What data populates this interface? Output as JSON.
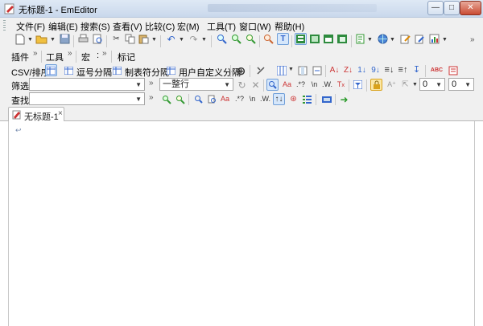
{
  "window": {
    "title": "无标题-1 - EmEditor",
    "minimize_glyph": "—",
    "maximize_glyph": "□",
    "close_glyph": "✕"
  },
  "menu": [
    {
      "label": "文件(F)"
    },
    {
      "label": "编辑(E)"
    },
    {
      "label": "搜索(S)"
    },
    {
      "label": "查看(V)"
    },
    {
      "label": "比较(C)"
    },
    {
      "label": "宏(M)"
    },
    {
      "label": "工具(T)"
    },
    {
      "label": "窗口(W)"
    },
    {
      "label": "帮助(H)"
    }
  ],
  "toolbar2": {
    "plugins_label": "插件",
    "tools_label": "工具",
    "macro_label": "宏",
    "macro_separator": ":",
    "markers_label": "标记",
    "chevron": "»"
  },
  "csv_bar": {
    "csv_sort_label": "CSV/排序",
    "comma_label": "逗号分隔",
    "tab_label": "制表符分隔",
    "user_label": "用户自定义分隔"
  },
  "filter_bar": {
    "filter_label": "筛选",
    "filter_value": "",
    "chevron": "»",
    "mode_value": "一整行",
    "num_select_1": "0",
    "num_select_2": "0"
  },
  "search_bar": {
    "find_label": "查找",
    "find_value": "",
    "chevron": "»"
  },
  "tabs": [
    {
      "label": "无标题-1",
      "close_glyph": "×"
    }
  ],
  "editor": {
    "eof_mark": "↩"
  },
  "icons": {
    "accent": "#2f6fce",
    "highlight": "#6f9ed8"
  }
}
